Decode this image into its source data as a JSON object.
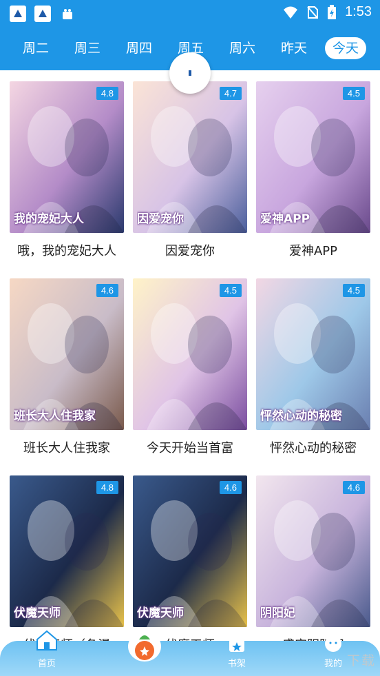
{
  "status_bar": {
    "time": "1:53",
    "icons": [
      "app-notification-icon",
      "app-notification-icon",
      "bag-icon",
      "wifi-icon",
      "no-sim-icon",
      "battery-icon"
    ]
  },
  "day_tabs": [
    "周二",
    "周三",
    "周四",
    "周五",
    "周六",
    "昨天",
    "今天"
  ],
  "active_tab": "今天",
  "comics": [
    {
      "title": "哦，我的宠妃大人",
      "rating": "4.8",
      "cover_text": "我的宠妃大人",
      "cover_colors": [
        "#f4d6e2",
        "#b48cc8",
        "#2b3a6e"
      ]
    },
    {
      "title": "因爱宠你",
      "rating": "4.7",
      "cover_text": "因爱宠你",
      "cover_colors": [
        "#fbe4d6",
        "#d7c3e6",
        "#4b5f9c"
      ]
    },
    {
      "title": "爱神APP",
      "rating": "4.5",
      "cover_text": "爱神APP",
      "cover_colors": [
        "#e6d0ee",
        "#c8a6de",
        "#6a4a8c"
      ]
    },
    {
      "title": "班长大人住我家",
      "rating": "4.6",
      "cover_text": "班长大人住我家",
      "cover_colors": [
        "#f6d8c4",
        "#c9bcc8",
        "#7a5a4c"
      ]
    },
    {
      "title": "今天开始当首富",
      "rating": "4.5",
      "cover_text": "",
      "cover_colors": [
        "#fff3c8",
        "#e0c4e6",
        "#7b4ea0"
      ]
    },
    {
      "title": "怦然心动的秘密",
      "rating": "4.5",
      "cover_text": "怦然心动的秘密",
      "cover_colors": [
        "#f2d7e4",
        "#9ec8e8",
        "#6a7fb0"
      ]
    },
    {
      "title": "伏魔天师（条漫",
      "rating": "4.8",
      "cover_text": "伏魔天师",
      "cover_colors": [
        "#3a5a8c",
        "#1c2a4a",
        "#e8c24a"
      ]
    },
    {
      "title": "伏魔天师",
      "rating": "4.6",
      "cover_text": "伏魔天师",
      "cover_colors": [
        "#3a5a8c",
        "#1c2a4a",
        "#e8c24a"
      ]
    },
    {
      "title": "盛宠阴阳妃",
      "rating": "4.6",
      "cover_text": "阴阳妃",
      "cover_colors": [
        "#f2e6ee",
        "#c8b4dc",
        "#4a5a8c"
      ]
    }
  ],
  "bottom_nav": {
    "home": "首页",
    "bookshelf": "书架",
    "mine": "我的"
  },
  "watermark": "下载",
  "colors": {
    "accent": "#1e96e6",
    "nav": "#6ec2f2",
    "badge": "#1e96e6"
  }
}
